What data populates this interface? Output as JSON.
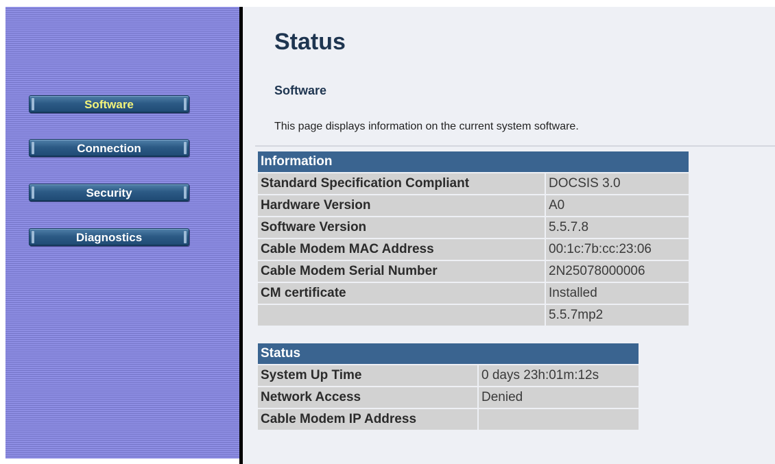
{
  "nav": {
    "items": [
      {
        "label": "Software",
        "active": true
      },
      {
        "label": "Connection",
        "active": false
      },
      {
        "label": "Security",
        "active": false
      },
      {
        "label": "Diagnostics",
        "active": false
      }
    ]
  },
  "page": {
    "title": "Status",
    "section": "Software",
    "description": "This page displays information on the current system software."
  },
  "info_table": {
    "header": "Information",
    "rows": [
      {
        "label": "Standard Specification Compliant",
        "value": "DOCSIS 3.0"
      },
      {
        "label": "Hardware Version",
        "value": "A0"
      },
      {
        "label": "Software Version",
        "value": "5.5.7.8"
      },
      {
        "label": "Cable Modem MAC Address",
        "value": "00:1c:7b:cc:23:06"
      },
      {
        "label": "Cable Modem Serial Number",
        "value": "2N25078000006"
      },
      {
        "label": "CM certificate",
        "value": "Installed"
      },
      {
        "label": "",
        "value": "5.5.7mp2"
      }
    ]
  },
  "status_table": {
    "header": "Status",
    "rows": [
      {
        "label": "System Up Time",
        "value": "0 days 23h:01m:12s"
      },
      {
        "label": "Network Access",
        "value": "Denied"
      },
      {
        "label": "Cable Modem IP Address",
        "value": ""
      }
    ]
  },
  "colors": {
    "sidebar": "#8e8ee4",
    "button": "#2c5a85",
    "active_label": "#f4f47a",
    "table_header": "#3a6490",
    "table_cell": "#d2d2d2",
    "main_bg": "#eef0f5"
  }
}
